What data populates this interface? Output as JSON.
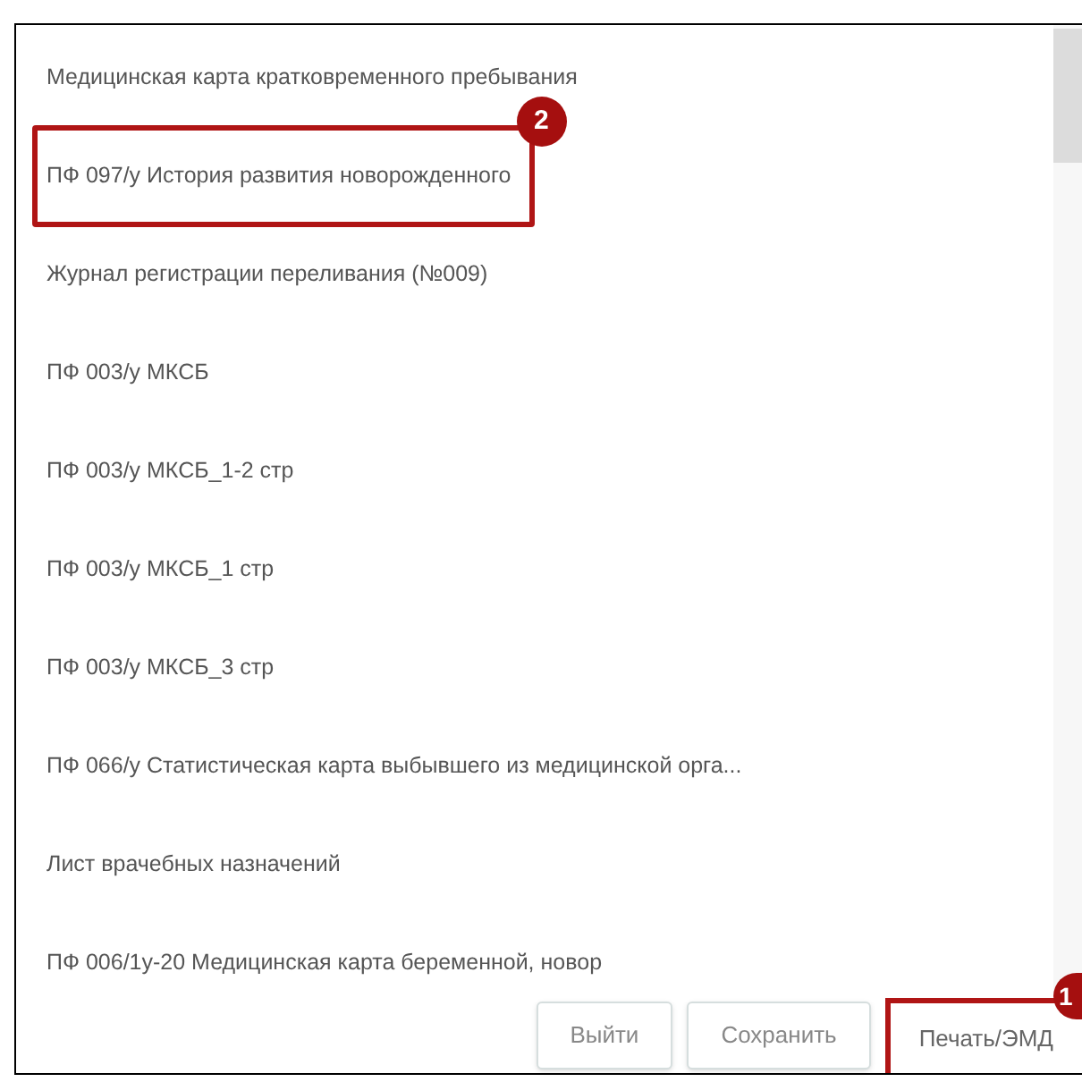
{
  "documents": [
    {
      "label": "Медицинская карта кратковременного пребывания"
    },
    {
      "label": "ПФ 097/у История развития новорожденного",
      "callout": "2"
    },
    {
      "label": "Журнал регистрации переливания (№009)"
    },
    {
      "label": "ПФ 003/у МКСБ"
    },
    {
      "label": "ПФ 003/у МКСБ_1-2 стр"
    },
    {
      "label": "ПФ 003/у МКСБ_1 стр"
    },
    {
      "label": "ПФ 003/у МКСБ_3 стр"
    },
    {
      "label": "ПФ 066/у Статистическая карта выбывшего из медицинской орга..."
    },
    {
      "label": "Лист врачебных назначений"
    },
    {
      "label": "ПФ 006/1у-20 Медицинская карта беременной, новор"
    }
  ],
  "buttons": [
    {
      "label": "Выйти"
    },
    {
      "label": "Сохранить"
    },
    {
      "label": "Печать/ЭМД",
      "callout": "1"
    }
  ]
}
